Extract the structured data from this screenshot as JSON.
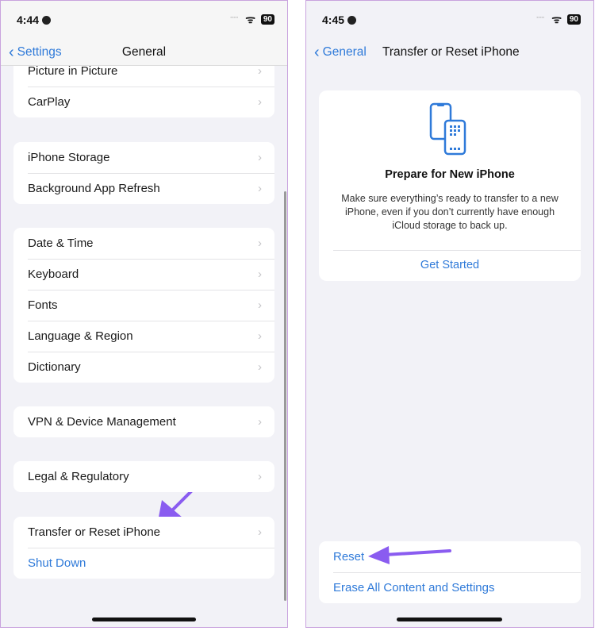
{
  "left": {
    "status": {
      "time": "4:44",
      "battery": "90"
    },
    "nav": {
      "back": "Settings",
      "title": "General"
    },
    "groups": [
      [
        "Picture in Picture",
        "CarPlay"
      ],
      [
        "iPhone Storage",
        "Background App Refresh"
      ],
      [
        "Date & Time",
        "Keyboard",
        "Fonts",
        "Language & Region",
        "Dictionary"
      ],
      [
        "VPN & Device Management"
      ],
      [
        "Legal & Regulatory"
      ],
      [
        "Transfer or Reset iPhone"
      ]
    ],
    "shut_down": "Shut Down"
  },
  "right": {
    "status": {
      "time": "4:45",
      "battery": "90"
    },
    "nav": {
      "back": "General",
      "title": "Transfer or Reset iPhone"
    },
    "card": {
      "title": "Prepare for New iPhone",
      "body": "Make sure everything’s ready to transfer to a new iPhone, even if you don’t currently have enough iCloud storage to back up.",
      "action": "Get Started"
    },
    "reset": "Reset",
    "erase": "Erase All Content and Settings"
  },
  "colors": {
    "accent": "#2f7ad9",
    "annotation_arrow": "#8a5cf0",
    "frame": "#c9a3de"
  }
}
